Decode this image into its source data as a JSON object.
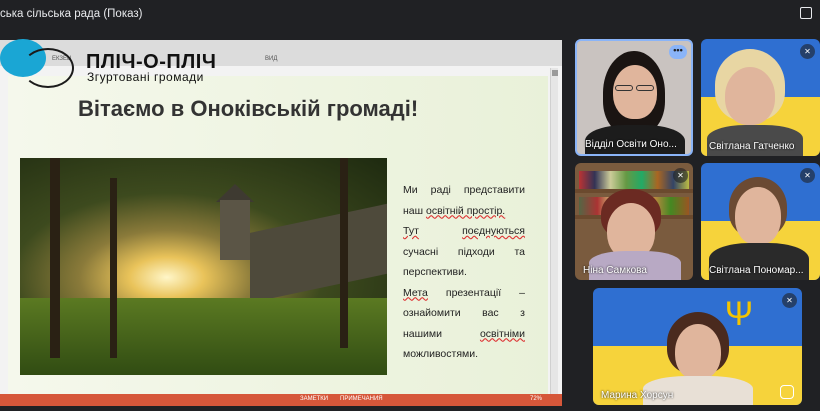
{
  "meeting": {
    "title": "ська сільська рада (Показ)"
  },
  "ppt": {
    "tabs": [
      "ЕКЗЕЦ",
      "ВИД"
    ],
    "status_notes": "ЗАМЕТКИ",
    "status_comments": "ПРИМЕЧАНИЯ",
    "zoom": "72%"
  },
  "logo": {
    "title": "ПЛІЧ-О-ПЛІЧ",
    "subtitle": "Згуртовані громади",
    "colors": {
      "bubble": "#1aa6d4",
      "ring": "#1b1b1b"
    }
  },
  "slide": {
    "title": "Вітаємо в Оноківській громаді!",
    "paragraph1_a": "Ми раді представити наш ",
    "paragraph1_b": "освітній простір.",
    "paragraph2_a": "Тут",
    "paragraph2_b": "поєднуються",
    "paragraph2_c": " сучасні підходи та перспективи.",
    "paragraph3_a": "Мета",
    "paragraph3_b": " презентації – ознайомити вас з нашими ",
    "paragraph3_c": "освітніми",
    "paragraph3_d": " можливостями."
  },
  "participants": [
    {
      "name": "Відділ Освіти Оно...",
      "active": true,
      "icon": "more-options-icon"
    },
    {
      "name": "Світлана Гатченко",
      "icon": "mic-off-icon"
    },
    {
      "name": "Ніна Самкова",
      "icon": "mic-off-icon"
    },
    {
      "name": "Світлана Пономар...",
      "icon": "mic-off-icon"
    },
    {
      "name": "Марина Хорсун",
      "icon": "mic-off-icon"
    }
  ],
  "colors": {
    "background": "#202124",
    "accent_border": "#8ab4f8",
    "ppt_status": "#d6573a",
    "flag_blue": "#2f6fd1",
    "flag_yellow": "#f6d33b"
  }
}
